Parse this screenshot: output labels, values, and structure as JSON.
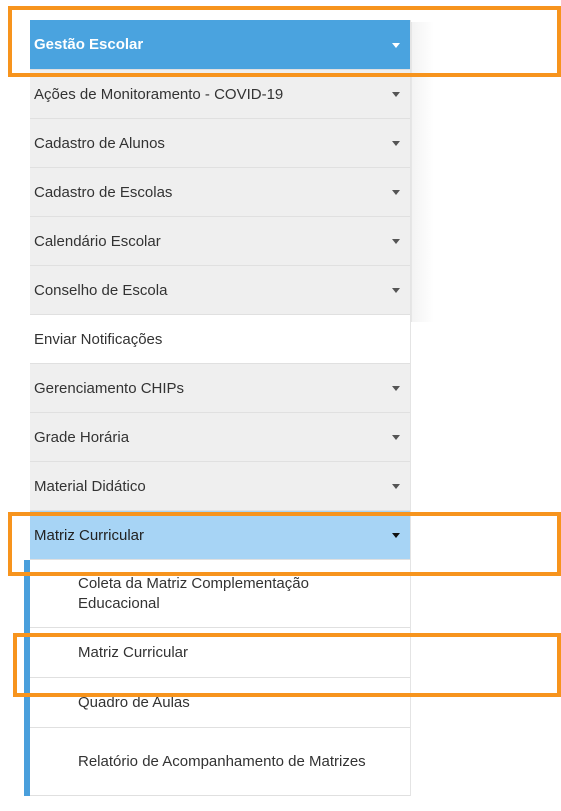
{
  "menu": {
    "header": {
      "label": "Gestão Escolar"
    },
    "items": [
      {
        "label": "Ações de Monitoramento - COVID-19",
        "has_submenu": true
      },
      {
        "label": "Cadastro de Alunos",
        "has_submenu": true
      },
      {
        "label": "Cadastro de Escolas",
        "has_submenu": true
      },
      {
        "label": "Calendário Escolar",
        "has_submenu": true
      },
      {
        "label": "Conselho de Escola",
        "has_submenu": true
      },
      {
        "label": "Enviar Notificações",
        "has_submenu": false
      },
      {
        "label": "Gerenciamento CHIPs",
        "has_submenu": true
      },
      {
        "label": "Grade Horária",
        "has_submenu": true
      },
      {
        "label": "Material Didático",
        "has_submenu": true
      },
      {
        "label": "Matriz Curricular",
        "has_submenu": true,
        "expanded": true
      }
    ],
    "submenu": [
      {
        "label": "Coleta da Matriz Complementação Educacional"
      },
      {
        "label": "Matriz Curricular"
      },
      {
        "label": "Quadro de Aulas"
      },
      {
        "label": "Relatório de Acompanhamento de Matrizes"
      }
    ]
  },
  "colors": {
    "header_bg": "#4aa3df",
    "active_bg": "#a7d4f5",
    "submenu_bar": "#4a9fdc",
    "highlight": "#f7941d"
  }
}
